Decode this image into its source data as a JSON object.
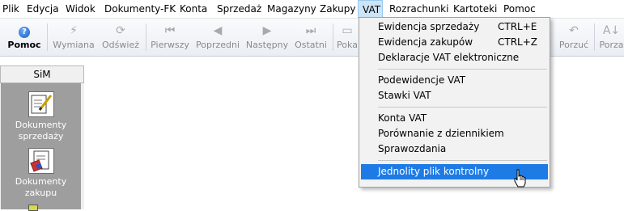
{
  "menubar": {
    "items": [
      "Plik",
      "Edycja",
      "Widok",
      "Dokumenty-FK",
      "Konta",
      "Sprzedaż",
      "Magazyny",
      "Zakupy",
      "VAT",
      "Rozrachunki",
      "Kartoteki",
      "Pomoc"
    ],
    "active": "VAT"
  },
  "toolbar": {
    "buttons": [
      {
        "label": "Pomoc",
        "icon": "help-icon",
        "enabled": true
      },
      {
        "label": "Wymiana",
        "icon": "exchange-icon",
        "enabled": false
      },
      {
        "label": "Odśwież",
        "icon": "refresh-icon",
        "enabled": false
      },
      {
        "label": "Pierwszy",
        "icon": "first-icon",
        "enabled": false
      },
      {
        "label": "Poprzedni",
        "icon": "previous-icon",
        "enabled": false
      },
      {
        "label": "Następny",
        "icon": "next-icon",
        "enabled": false
      },
      {
        "label": "Ostatni",
        "icon": "last-icon",
        "enabled": false
      },
      {
        "label": "Poka",
        "icon": "show-icon",
        "enabled": false
      },
      {
        "label": "Porzuć",
        "icon": "undo-icon",
        "enabled": false
      },
      {
        "label": "Porza",
        "icon": "sort-icon",
        "enabled": false
      }
    ]
  },
  "left_panel": {
    "title": "SiM",
    "items": [
      {
        "label_line1": "Dokumenty",
        "label_line2": "sprzedaży",
        "icon": "sales-document-icon"
      },
      {
        "label_line1": "Dokumenty",
        "label_line2": "zakupu",
        "icon": "purchase-document-icon"
      }
    ]
  },
  "vat_menu": {
    "items": [
      {
        "label": "Ewidencja sprzedaży",
        "shortcut": "CTRL+E"
      },
      {
        "label": "Ewidencja zakupów",
        "shortcut": "CTRL+Z"
      },
      {
        "label": "Deklaracje VAT elektroniczne",
        "shortcut": ""
      },
      {
        "label": "Podewidencje VAT",
        "shortcut": ""
      },
      {
        "label": "Stawki VAT",
        "shortcut": ""
      },
      {
        "label": "Konta VAT",
        "shortcut": ""
      },
      {
        "label": "Porównanie z dziennikiem",
        "shortcut": ""
      },
      {
        "label": "Sprawozdania",
        "shortcut": ""
      },
      {
        "label": "Jednolity plik kontrolny",
        "shortcut": "",
        "highlighted": true
      }
    ],
    "highlight_color": "#1e7be6"
  }
}
